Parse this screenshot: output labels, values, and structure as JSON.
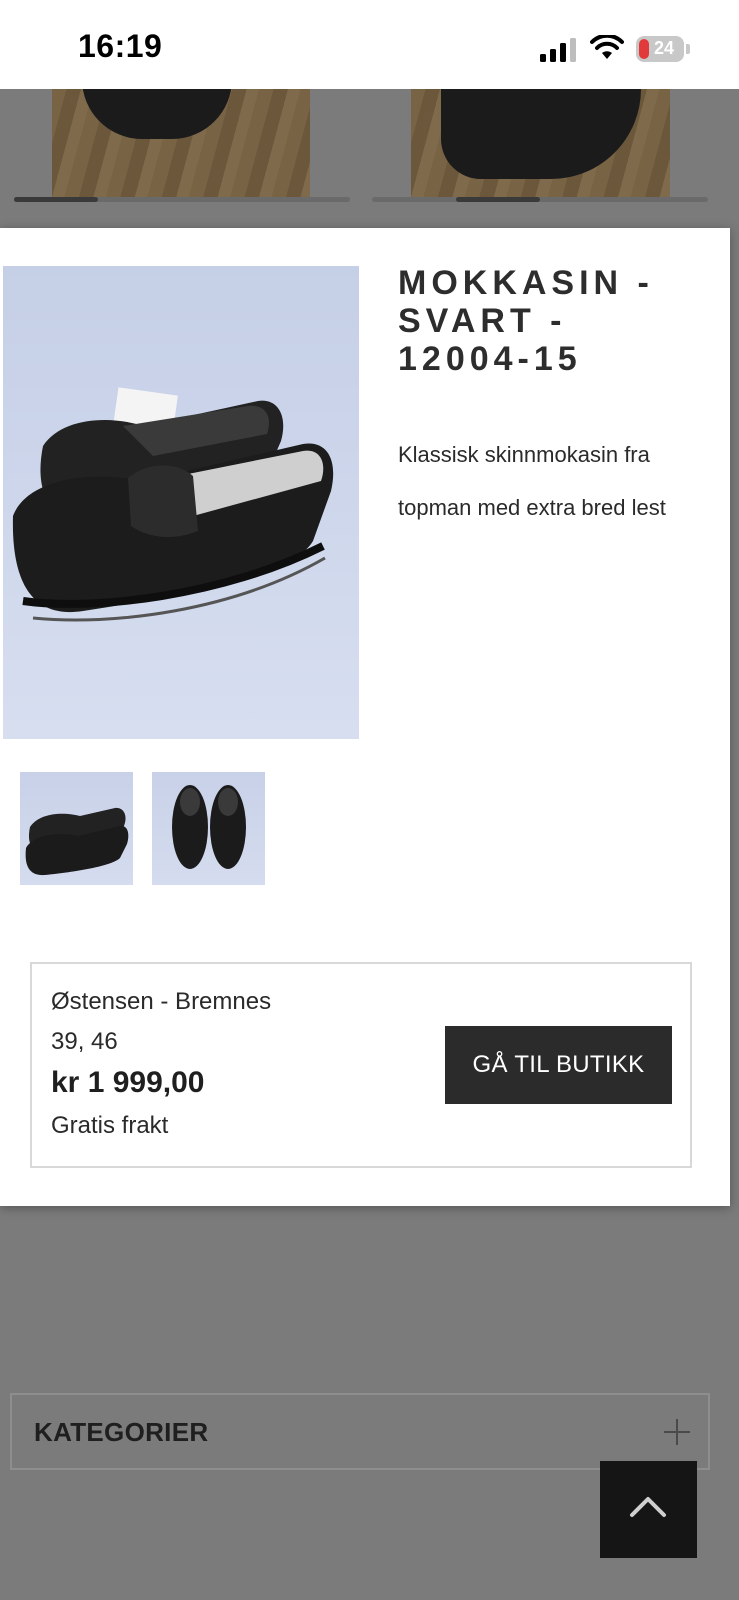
{
  "status_bar": {
    "time": "16:19",
    "battery_level": "24",
    "icons": [
      "signal-icon",
      "wifi-icon",
      "battery-icon"
    ]
  },
  "product": {
    "title": "MOKKASIN - SVART - 12004-15",
    "description": "Klassisk skinnmokasin fra topman med extra bred lest",
    "main_image": "black-leather-moccasins-photo",
    "thumbnails": [
      "moccasins-side-view",
      "moccasins-front-view"
    ]
  },
  "offer": {
    "shop": "Østensen - Bremnes",
    "sizes": "39, 46",
    "price": "kr 1 999,00",
    "shipping": "Gratis frakt",
    "button_label": "GÅ TIL BUTIKK"
  },
  "background": {
    "categories_label": "KATEGORIER",
    "expand_icon": "plus-icon",
    "back_to_top_icon": "chevron-up-icon"
  },
  "colors": {
    "overlay": "#7b7b7b",
    "button_bg": "#2b2b2b",
    "back_to_top_bg": "#151515",
    "battery_charge": "#e23a3a"
  }
}
